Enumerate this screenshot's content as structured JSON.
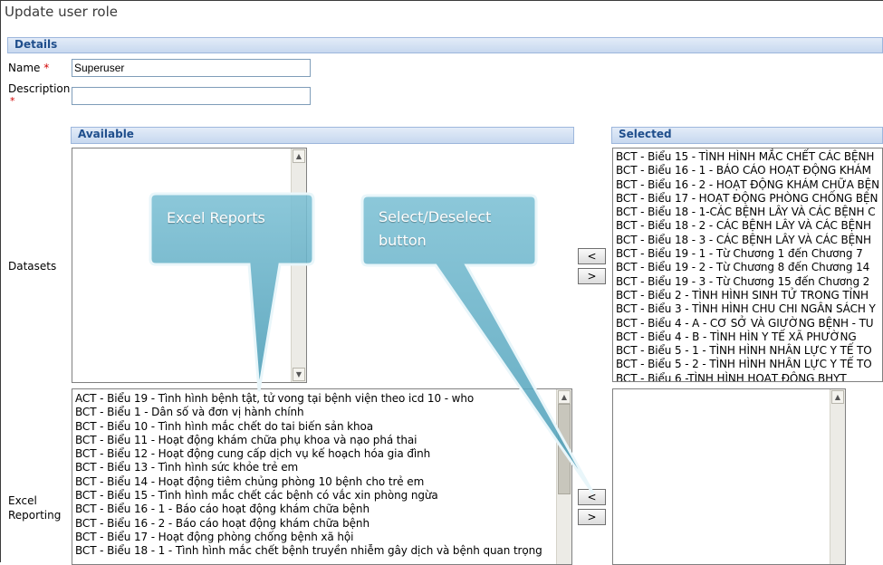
{
  "page": {
    "title": "Update user role"
  },
  "details": {
    "header": "Details",
    "name_label": "Name",
    "name_value": "Superuser",
    "description_label": "Description",
    "description_value": "",
    "required_mark": "*"
  },
  "datasets": {
    "label": "Datasets",
    "available_header": "Available",
    "selected_header": "Selected",
    "selected_items": [
      "BCT - Biểu 15 - TÌNH HÌNH MẮC CHẾT CÁC BỆNH",
      "BCT - Biểu 16 - 1 - BÁO CÁO HOẠT ĐỘNG KHÁM",
      "BCT - Biểu 16 - 2 - HOẠT ĐỘNG KHÁM CHỮA BỆN",
      "BCT - Biểu 17 - HOẠT ĐỘNG PHÒNG CHỐNG BỆN",
      "BCT - Biểu 18 - 1-CÁC BỆNH LÂY VÀ CÁC BỆNH C",
      "BCT - Biểu 18 - 2 - CÁC BỆNH LÂY VÀ CÁC BỆNH",
      "BCT - Biểu 18 - 3 - CÁC BỆNH LÂY VÀ CÁC BỆNH",
      "BCT - Biểu 19 - 1 - Từ Chương 1 đến Chương 7",
      "BCT - Biểu 19 - 2 - Từ Chương 8 đến Chương 14",
      "BCT - Biểu 19 - 3 - Từ Chương 15 đến Chương 2",
      "BCT - Biểu 2 - TÌNH HÌNH SINH TỬ TRONG TỈNH",
      "BCT - Biểu 3 - TÌNH HÌNH CHU CHI NGÂN SÁCH Y",
      "BCT - Biểu 4 - A - CƠ SỞ VÀ GIƯỜNG BỆNH - TU",
      "BCT - Biểu 4 - B - TÌNH HÌN Y TẾ XÃ PHƯỜNG",
      "BCT - Biểu 5 - 1 - TÌNH HÌNH NHÂN LỰC Y TẾ TO",
      "BCT - Biểu 5 - 2 - TÌNH HÌNH NHÂN LỰC Y TẾ TO",
      "BCT - Biểu 6 -TÌNH HÌNH HOẠT ĐỘNG BHYT"
    ],
    "btn_left": "<",
    "btn_right": ">"
  },
  "excel": {
    "label_line1": "Excel",
    "label_line2": "Reporting",
    "available_items": [
      "ACT - Biểu 19 - Tình hình bệnh tật, tử vong tại bệnh viện theo icd 10 - who",
      "BCT - Biểu 1 - Dân số và đơn vị hành chính",
      "BCT - Biểu 10 - Tình hình mắc chết do tai biến sản khoa",
      "BCT - Biểu 11 - Hoạt động khám chữa phụ khoa và nạo phá thai",
      "BCT - Biểu 12 - Hoạt động cung cấp dịch vụ kế hoạch hóa gia đình",
      "BCT - Biểu 13 - Tình hình sức khỏe trẻ em",
      "BCT - Biểu 14 - Hoạt động tiêm chủng phòng 10 bệnh cho trẻ em",
      "BCT - Biểu 15 - Tình hình mắc chết các bệnh có vắc xin phòng ngừa",
      "BCT - Biểu 16 - 1 - Báo cáo hoạt động khám chữa bệnh",
      "BCT - Biểu 16 - 2 - Báo cáo hoạt động khám chữa bệnh",
      "BCT - Biểu 17 - Hoạt động phòng chống bệnh xã hội",
      "BCT - Biểu 18 - 1 - Tình hình mắc chết bệnh truyền nhiễm gây dịch và bệnh quan trọng"
    ],
    "btn_left": "<",
    "btn_right": ">"
  },
  "callouts": {
    "excel_reports": "Excel Reports",
    "select_line1": "Select/Deselect",
    "select_line2": "button"
  },
  "colors": {
    "section_text": "#1f4e8c",
    "callout_fill": "#5aa8bf",
    "required": "#d00000"
  }
}
